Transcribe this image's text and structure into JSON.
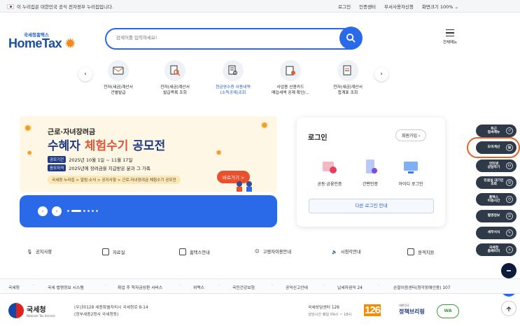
{
  "topbar": {
    "notice": "이 누리집은 대한민국 공식 전자정부 누리집입니다.",
    "links": [
      "로그인",
      "인증센터",
      "부서사용자신청",
      "화면크기 100%"
    ]
  },
  "header": {
    "logo_small": "국세청홈택스",
    "logo_big": "HomeTax",
    "search_placeholder": "검색어를 입력하세요!",
    "menu_label": "전체메뉴"
  },
  "quick": [
    {
      "line1": "전자(세금)계산서",
      "line2": "건별발급"
    },
    {
      "line1": "전자(세금)계산서",
      "line2": "발급목록 조회"
    },
    {
      "line1": "현금영수증 사용내역",
      "line2": "(소득공제)조회"
    },
    {
      "line1": "사업용 신용카드",
      "line2": "매입세액 공제 확인/..."
    },
    {
      "line1": "전자(세금)계산서",
      "line2": "합계표 조회"
    }
  ],
  "banner": {
    "line1": "근로·자녀장려금",
    "line2_a": "수혜자 ",
    "line2_b": "체험수기",
    "line2_c": " 공모전",
    "tag1": "공모기간",
    "text1": "2025년 10월 1일 ~ 11월 17일",
    "tag2": "응모자격",
    "text2": "2025년에 장려금을 지급받은 분과 그 가족",
    "path": "국세청 누리집 > 알림·소식 > 공지사항 > 근로·자녀장려금 체험수기 공모전",
    "go": "바로가기 >"
  },
  "login": {
    "title": "로그인",
    "join": "회원가입",
    "options": [
      "공동·금융인증",
      "간편인증",
      "아이디 로그인"
    ],
    "other": "다른 로그인 안내"
  },
  "floating": [
    {
      "l1": "최근",
      "l2": "접속메뉴"
    },
    {
      "l1": "모의계산",
      "l2": ""
    },
    {
      "l1": "인터넷",
      "l2": "상담하기"
    },
    {
      "l1": "민원실 대기인",
      "l2": "조회"
    },
    {
      "l1": "홈택스",
      "l2": "이용시간"
    },
    {
      "l1": "별명정보",
      "l2": ""
    },
    {
      "l1": "세무서식",
      "l2": ""
    },
    {
      "l1": "국세청",
      "l2": "홈페이지"
    }
  ],
  "quicklinks": [
    "공지사항",
    "자료실",
    "홈택스안내",
    "고령자이용안내",
    "시청각안내",
    "원격지원"
  ],
  "footer": {
    "links": [
      "국세청",
      "국세 법령정보 시스템",
      "취업 후 학자금상환 서비스",
      "위택스",
      "국민건강보험",
      "공익신고안내",
      "납세자권익 24",
      "손말이음센터(청각장애인용) 107"
    ],
    "org": "국세청",
    "org_sub": "National Tax Service",
    "addr1": "(우)30128 세종특별자치시 국세청로 8-14",
    "addr2": "(정부세종2청사 국세청동)",
    "center1": "국세상담센터 126",
    "center2": "상담시간 평일 09시 ~ 18시",
    "n126": "126",
    "policy_small": "대한민국",
    "policy_big": "정책브리핑",
    "wa": "WA"
  },
  "colors": {
    "accent": "#2a6ae8",
    "brand": "#1a4fa0",
    "highlight": "#e8601c",
    "floating": "#2f3a48"
  }
}
